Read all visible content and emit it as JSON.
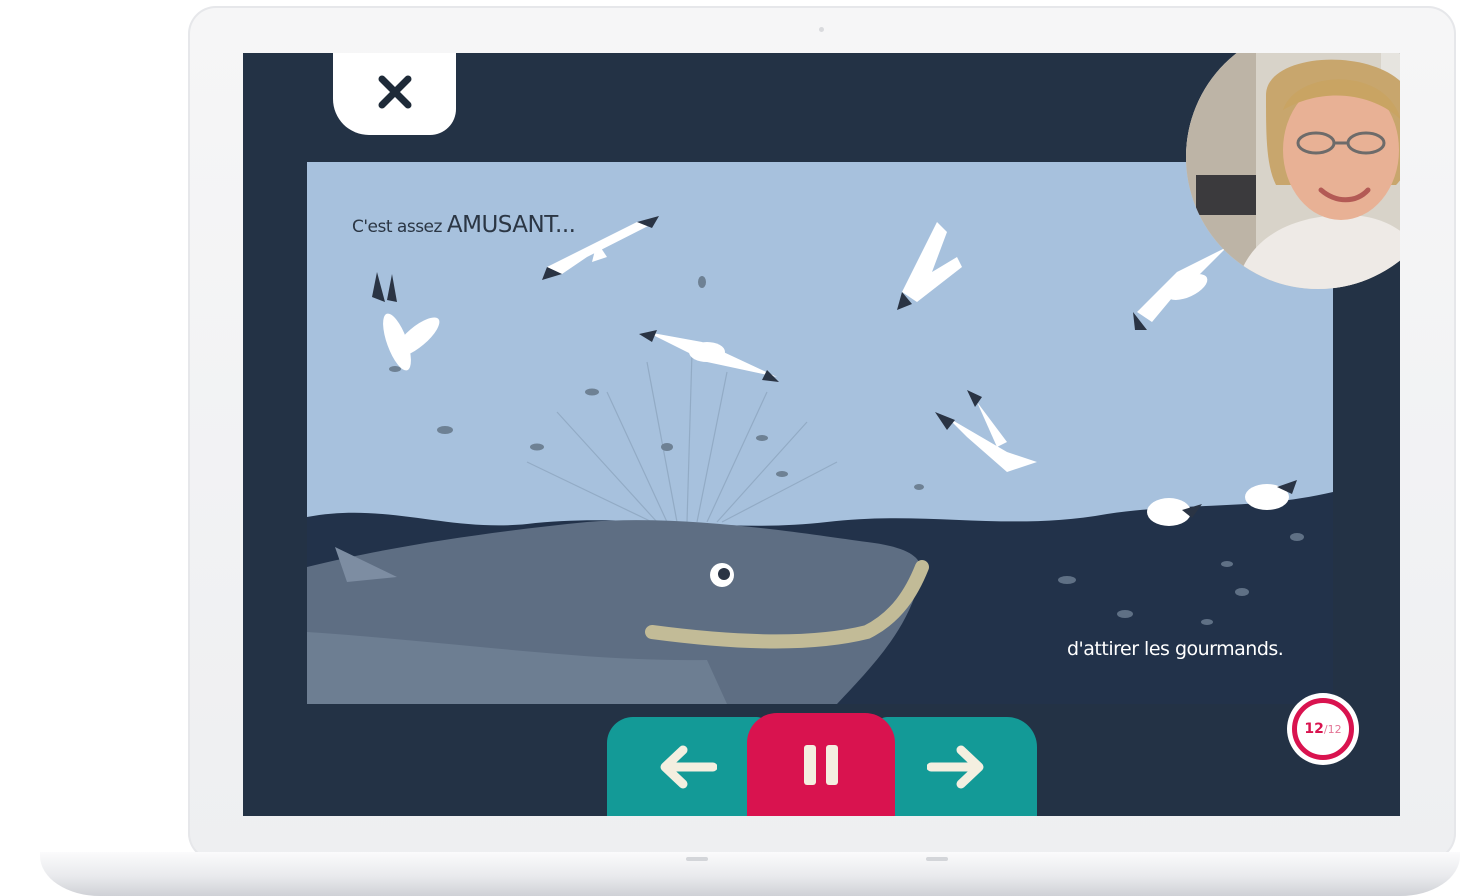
{
  "reader": {
    "page_current": "12",
    "page_total": "/12",
    "close_label": "✕"
  },
  "story": {
    "caption_top_small": "C'est assez",
    "caption_top_big": "AMUSANT...",
    "caption_bottom": "d'attirer les gourmands."
  },
  "controls": {
    "prev_icon": "arrow-left-icon",
    "pause_icon": "pause-icon",
    "next_icon": "arrow-right-icon"
  },
  "colors": {
    "screen_bg": "#233245",
    "sky": "#a7c1dd",
    "sea": "#22324a",
    "accent_teal": "#139a97",
    "accent_pink": "#d9134f"
  }
}
